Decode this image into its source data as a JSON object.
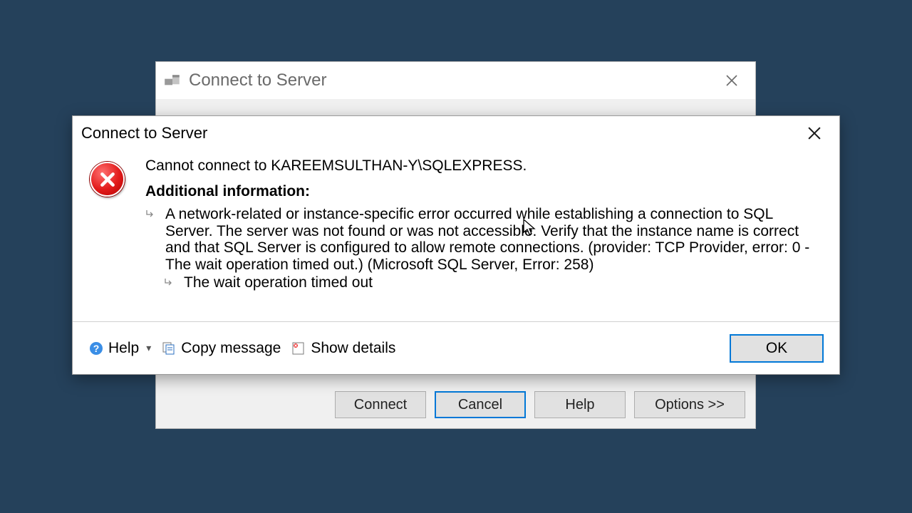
{
  "backDialog": {
    "title": "Connect to Server",
    "buttons": {
      "connect": "Connect",
      "cancel": "Cancel",
      "help": "Help",
      "options": "Options >>"
    }
  },
  "errorDialog": {
    "title": "Connect to Server",
    "message": "Cannot connect to KAREEMSULTHAN-Y\\SQLEXPRESS.",
    "additionalHeading": "Additional information:",
    "detail1": "A network-related or instance-specific error occurred while establishing a connection to SQL Server. The server was not found or was not accessible. Verify that the instance name is correct and that SQL Server is configured to allow remote connections. (provider: TCP Provider, error: 0 - The wait operation timed out.) (Microsoft SQL Server, Error: 258)",
    "detail2": "The wait operation timed out",
    "toolbar": {
      "help": "Help",
      "copy": "Copy message",
      "showDetails": "Show details",
      "ok": "OK"
    }
  }
}
